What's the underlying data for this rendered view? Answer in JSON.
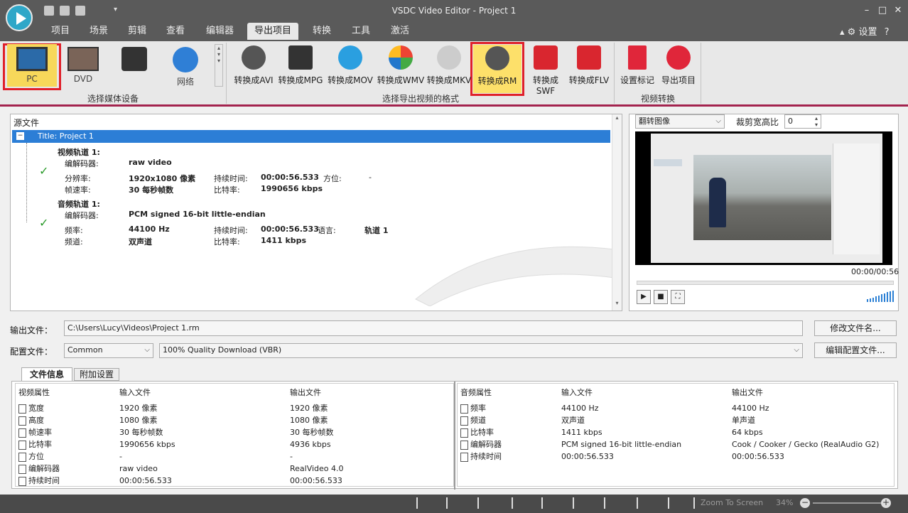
{
  "window": {
    "title": "VSDC Video Editor - Project 1"
  },
  "menu_tabs": [
    "项目",
    "场景",
    "剪辑",
    "查看",
    "编辑器",
    "导出项目",
    "转换",
    "工具",
    "激活"
  ],
  "settings_label": "设置",
  "ribbon": {
    "devices": [
      "PC",
      "DVD",
      "",
      "网络"
    ],
    "device_group_label": "选择媒体设备",
    "formats": [
      "转换成AVI",
      "转换成MPG",
      "转换成MOV",
      "转换成WMV",
      "转换成MKV",
      "转换成RM",
      "转换成SWF",
      "转换成FLV"
    ],
    "format_group_label": "选择导出视频的格式",
    "actions": [
      "设置标记",
      "导出项目"
    ],
    "action_group_label": "视频转换"
  },
  "source": {
    "header": "源文件",
    "project_title": "Title: Project 1",
    "video": {
      "title": "视频轨道 1:",
      "codec_label": "编解码器:",
      "codec": "raw video",
      "res_label": "分辨率:",
      "res": "1920x1080 像素",
      "dur_label": "持续时间:",
      "dur": "00:00:56.533",
      "orient_label": "方位:",
      "orient": "-",
      "fps_label": "帧速率:",
      "fps": "30 每秒帧数",
      "bitrate_label": "比特率:",
      "bitrate": "1990656 kbps"
    },
    "audio": {
      "title": "音频轨道 1:",
      "codec_label": "编解码器:",
      "codec": "PCM signed 16-bit little-endian",
      "freq_label": "频率:",
      "freq": "44100 Hz",
      "dur_label": "持续时间:",
      "dur": "00:00:56.533",
      "lang_label": "语言:",
      "lang": "轨道 1",
      "ch_label": "频道:",
      "ch": "双声道",
      "bitrate_label": "比特率:",
      "bitrate": "1411 kbps"
    }
  },
  "preview": {
    "flip_label": "翻转图像",
    "ratio_label": "裁剪宽高比",
    "ratio_value": "0",
    "time": "00:00/00:56"
  },
  "output": {
    "file_label": "输出文件：",
    "file_path": "C:\\Users\\Lucy\\Videos\\Project 1.rm",
    "rename_button": "修改文件名...",
    "profile_label": "配置文件：",
    "profile_value": "Common",
    "quality_value": "100% Quality Download (VBR)",
    "edit_profile_button": "编辑配置文件..."
  },
  "info_tabs": [
    "文件信息",
    "附加设置"
  ],
  "video_props": {
    "headers": [
      "视频属性",
      "输入文件",
      "输出文件"
    ],
    "rows": [
      [
        "宽度",
        "1920 像素",
        "1920 像素"
      ],
      [
        "高度",
        "1080 像素",
        "1080 像素"
      ],
      [
        "帧速率",
        "30 每秒帧数",
        "30 每秒帧数"
      ],
      [
        "比特率",
        "1990656 kbps",
        "4936 kbps"
      ],
      [
        "方位",
        "-",
        "-"
      ],
      [
        "编解码器",
        "raw video",
        "RealVideo 4.0"
      ],
      [
        "持续时间",
        "00:00:56.533",
        "00:00:56.533"
      ]
    ]
  },
  "audio_props": {
    "headers": [
      "音频属性",
      "输入文件",
      "输出文件"
    ],
    "rows": [
      [
        "频率",
        "44100 Hz",
        "44100 Hz"
      ],
      [
        "频道",
        "双声道",
        "单声道"
      ],
      [
        "比特率",
        "1411 kbps",
        "64 kbps"
      ],
      [
        "编解码器",
        "PCM signed 16-bit little-endian",
        "Cook / Cooker / Gecko (RealAudio G2)"
      ],
      [
        "持续时间",
        "00:00:56.533",
        "00:00:56.533"
      ]
    ]
  },
  "status": {
    "zoom_label": "Zoom To Screen",
    "zoom_value": "34%"
  }
}
